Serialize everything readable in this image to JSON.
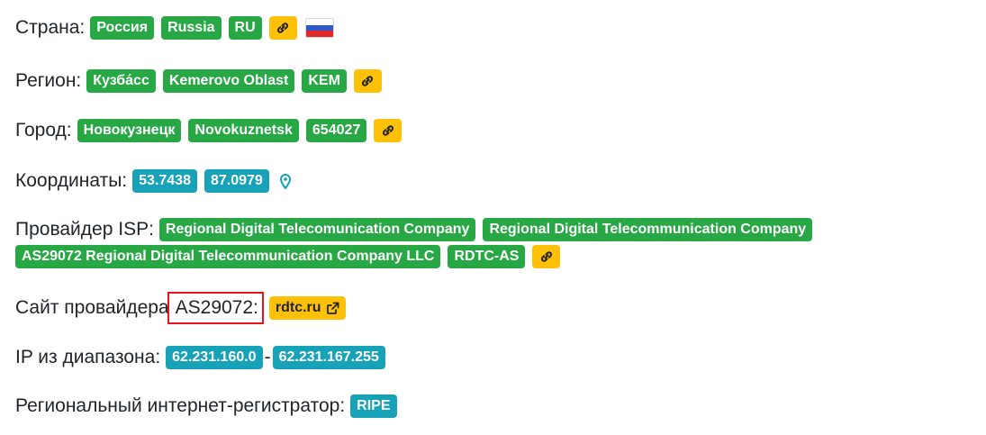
{
  "country": {
    "label": "Страна:",
    "badges": [
      "Россия",
      "Russia",
      "RU"
    ],
    "link_icon": "link-icon",
    "flag": "russia-flag"
  },
  "region": {
    "label": "Регион:",
    "badges": [
      "Кузба́сс",
      "Kemerovo Oblast",
      "KEM"
    ],
    "link_icon": "link-icon"
  },
  "city": {
    "label": "Город:",
    "badges": [
      "Новокузнецк",
      "Novokuznetsk",
      "654027"
    ],
    "link_icon": "link-icon"
  },
  "coordinates": {
    "label": "Координаты:",
    "lat": "53.7438",
    "lon": "87.0979",
    "map_icon": "map-pin-icon"
  },
  "isp": {
    "label": "Провайдер ISP:",
    "badges": [
      "Regional Digital Telecomunication Company",
      "Regional Digital Telecommunication Company",
      "AS29072 Regional Digital Telecommunication Company LLC",
      "RDTC-AS"
    ],
    "link_icon": "link-icon"
  },
  "provider_site": {
    "label": "Сайт провайдера",
    "asn": "AS29072:",
    "site": "rdtc.ru",
    "external_icon": "external-link-icon"
  },
  "ip_range": {
    "label": "IP из диапазона:",
    "start": "62.231.160.0",
    "separator": "-",
    "end": "62.231.167.255"
  },
  "registrar": {
    "label": "Региональный интернет-регистратор:",
    "value": "RIPE"
  },
  "colors": {
    "green": "#28a745",
    "teal": "#17a2b8",
    "yellow": "#ffc107",
    "highlight": "#e8141c"
  }
}
